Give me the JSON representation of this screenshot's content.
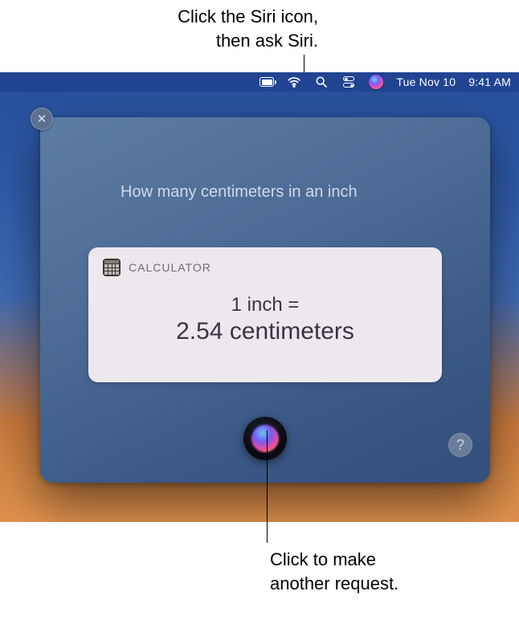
{
  "callouts": {
    "top_line1": "Click the Siri icon,",
    "top_line2": "then ask Siri.",
    "bottom_line1": "Click to make",
    "bottom_line2": "another request."
  },
  "menubar": {
    "date": "Tue Nov 10",
    "time": "9:41 AM"
  },
  "siri": {
    "query": "How many centimeters in an inch",
    "help_label": "?",
    "close_glyph": "✕"
  },
  "answer": {
    "app_label": "CALCULATOR",
    "line1": "1 inch =",
    "line2": "2.54 centimeters"
  }
}
